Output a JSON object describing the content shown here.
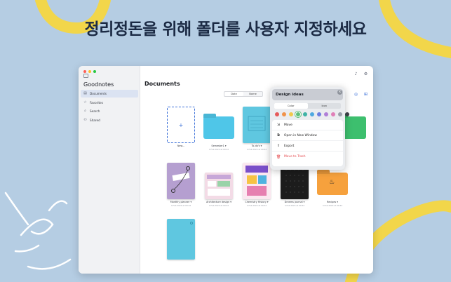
{
  "headline": "정리정돈을 위해 폴더를 사용자 지정하세요",
  "colors": {
    "background": "#b5cde3",
    "accent_yellow": "#f2d64a",
    "brand_blue": "#3a6fd8",
    "danger": "#e5484d"
  },
  "sidebar": {
    "brand": "Goodnotes",
    "items": [
      {
        "label": "Documents",
        "icon": "documents-icon"
      },
      {
        "label": "Favorites",
        "icon": "star-icon"
      },
      {
        "label": "Search",
        "icon": "search-icon"
      },
      {
        "label": "Shared",
        "icon": "shared-icon"
      }
    ]
  },
  "main": {
    "title": "Documents",
    "sort": [
      "Date",
      "Name"
    ],
    "top_icons": [
      "bell-icon",
      "gear-icon",
      "select-icon",
      "grid-view-icon"
    ]
  },
  "documents": [
    {
      "label": "New...",
      "sub": "",
      "kind": "new"
    },
    {
      "label": "Semester1 ▾",
      "sub": "4 Feb 2024 at 09:42",
      "kind": "folder",
      "color": "#4fc6e8"
    },
    {
      "label": "To-do's ▾",
      "sub": "4 Feb 2024 at 09:42",
      "kind": "notebook",
      "color": "#5fc7e0"
    },
    {
      "label": "",
      "sub": "",
      "kind": "hidden-folder",
      "color": "#f2c94c"
    },
    {
      "label": "",
      "sub": "",
      "kind": "hidden-folder",
      "color": "#3dbf6e"
    },
    {
      "label": "Monthly planner ▾",
      "sub": "4 Feb 2024 at 09:42",
      "kind": "planner",
      "color": "#b59fd0"
    },
    {
      "label": "Architecture design ▾",
      "sub": "4 Feb 2024 at 09:42",
      "kind": "arch",
      "color": "#f3dbe6"
    },
    {
      "label": "Chemistry History ▾",
      "sub": "4 Feb 2024 at 09:42",
      "kind": "chem",
      "color": "#fbe8f0"
    },
    {
      "label": "Dreams journal ▾",
      "sub": "4 Feb 2024 at 09:42",
      "kind": "dark",
      "color": "#1c1c1c"
    },
    {
      "label": "Recipes ▾",
      "sub": "4 Feb 2024 at 09:42",
      "kind": "folder",
      "color": "#f6a13d"
    },
    {
      "label": "",
      "sub": "",
      "kind": "notebook",
      "color": "#5fc7e0"
    }
  ],
  "popover": {
    "title": "Design ideas",
    "tabs": [
      "Color",
      "Icon"
    ],
    "swatches": [
      "#e65a5a",
      "#f0934a",
      "#f2c94c",
      "#5fbf7a",
      "#3fb3a6",
      "#4fa9e0",
      "#6d7ee0",
      "#b07fd8",
      "#e07fb8",
      "#9aa0aa",
      "#3a3d44"
    ],
    "menu": [
      {
        "label": "Move",
        "icon": "move-icon"
      },
      {
        "label": "Open in New Window",
        "icon": "new-window-icon"
      },
      {
        "label": "Export",
        "icon": "export-icon"
      },
      {
        "label": "Move to Trash",
        "icon": "trash-icon",
        "danger": true
      }
    ]
  }
}
